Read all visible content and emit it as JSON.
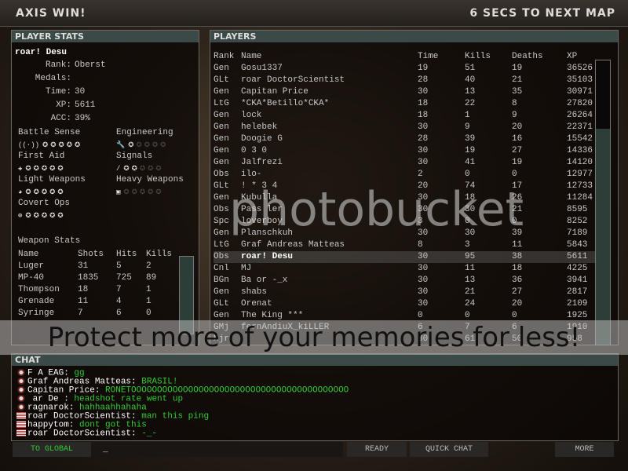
{
  "header": {
    "result": "AXIS WIN!",
    "countdown": "6 SECS TO NEXT MAP"
  },
  "player_stats": {
    "title": "PLAYER STATS",
    "name": "roar! Desu",
    "fields": [
      {
        "label": "Rank:",
        "value": "Oberst"
      },
      {
        "label": "Medals:",
        "value": ""
      },
      {
        "label": "Time:",
        "value": "30"
      },
      {
        "label": "XP:",
        "value": "5611"
      },
      {
        "label": "ACC:",
        "value": "39%"
      }
    ],
    "skills": [
      {
        "name": "Battle Sense",
        "icon": "radio-icon",
        "level": 5
      },
      {
        "name": "Engineering",
        "icon": "wrench-icon",
        "level": 1
      },
      {
        "name": "First Aid",
        "icon": "medic-cross-icon",
        "level": 5
      },
      {
        "name": "Signals",
        "icon": "signals-icon",
        "level": 2
      },
      {
        "name": "Light Weapons",
        "icon": "pistol-icon",
        "level": 5
      },
      {
        "name": "Heavy Weapons",
        "icon": "heavy-weapon-icon",
        "level": 0
      },
      {
        "name": "Covert Ops",
        "icon": "crosshair-icon",
        "level": 5
      }
    ],
    "weapon_stats": {
      "title": "Weapon Stats",
      "columns": [
        "Name",
        "Shots",
        "Hits",
        "Kills"
      ],
      "rows": [
        [
          "Luger",
          "31",
          "5",
          "2"
        ],
        [
          "MP-40",
          "1835",
          "725",
          "89"
        ],
        [
          "Thompson",
          "18",
          "7",
          "1"
        ],
        [
          "Grenade",
          "11",
          "4",
          "1"
        ],
        [
          "Syringe",
          "7",
          "6",
          "0"
        ]
      ]
    }
  },
  "players": {
    "title": "PLAYERS",
    "columns": [
      "Rank",
      "Name",
      "Time",
      "Kills",
      "Deaths",
      "XP"
    ],
    "rows": [
      [
        "Gen",
        "Gosu1337",
        "19",
        "51",
        "19",
        "36526"
      ],
      [
        "GLt",
        "roar DoctorScientist",
        "28",
        "40",
        "21",
        "35103"
      ],
      [
        "Gen",
        "Capitan Price",
        "30",
        "13",
        "35",
        "30971"
      ],
      [
        "LtG",
        "*CKA*Betillo*CKA*",
        "18",
        "22",
        "8",
        "27820"
      ],
      [
        "Gen",
        "lock",
        "18",
        "1",
        "9",
        "26264"
      ],
      [
        "Gen",
        "helebek",
        "30",
        "9",
        "20",
        "22371"
      ],
      [
        "Gen",
        "Doogie G",
        "28",
        "39",
        "16",
        "15542"
      ],
      [
        "Gen",
        " 0 3  0",
        "30",
        "19",
        "27",
        "14336"
      ],
      [
        "Gen",
        "Jalfrezi",
        "30",
        "41",
        "19",
        "14120"
      ],
      [
        "Obs",
        "  ilo-",
        "2",
        "0",
        "0",
        "12977"
      ],
      [
        "GLt",
        "  !  * 3  4",
        "20",
        "74",
        "17",
        "12733"
      ],
      [
        "Gen",
        "Kubulla",
        "30",
        "18",
        "26",
        "11284"
      ],
      [
        "Obs",
        "Pass   ler",
        "30",
        "30",
        "21",
        "8595"
      ],
      [
        "Spc",
        "loverboy",
        "3",
        "0",
        "0",
        "8252"
      ],
      [
        "Gen",
        "Planschkuh",
        "30",
        "30",
        "39",
        "7189"
      ],
      [
        "LtG",
        "Graf Andreas Matteas",
        "8",
        "3",
        "11",
        "5843"
      ],
      [
        "Obs",
        "roar! Desu",
        "30",
        "95",
        "38",
        "5611"
      ],
      [
        "Cnl",
        "MJ",
        "30",
        "11",
        "18",
        "4225"
      ],
      [
        "BGn",
        "Ba   or -_x",
        "30",
        "13",
        "36",
        "3941"
      ],
      [
        "Gen",
        "shabs",
        "30",
        "21",
        "27",
        "2817"
      ],
      [
        "GLt",
        "Orenat",
        "30",
        "24",
        "20",
        "2109"
      ],
      [
        "Gen",
        "The King ***",
        "0",
        "0",
        "0",
        "1925"
      ],
      [
        "GMj",
        "fernAndiuX_kiLLER",
        "6",
        "7",
        "6",
        "1910"
      ],
      [
        "Mjr",
        "",
        "30",
        "61",
        "50",
        "958"
      ]
    ],
    "highlight_index": 16
  },
  "chat": {
    "title": "CHAT",
    "lines": [
      {
        "flag": "axis",
        "name": "F A    EAG",
        "msg": "gg"
      },
      {
        "flag": "axis",
        "name": "Graf Andreas Matteas",
        "msg": "BRASIL!"
      },
      {
        "flag": "axis",
        "name": "Capitan Price",
        "msg": "RONETOOOOOOOOOOOOOOOOOOOOOOOOOOOOOOOOOOOOOOOOOO"
      },
      {
        "flag": "axis",
        "name": " ar  De  ",
        "msg": "headshot rate went up"
      },
      {
        "flag": "axis",
        "name": "ragnarok",
        "msg": "hahhaahhahaha"
      },
      {
        "flag": "us",
        "name": "roar DoctorScientist",
        "msg": "man this ping"
      },
      {
        "flag": "us",
        "name": "happytom",
        "msg": "dont got this"
      },
      {
        "flag": "us",
        "name": "roar DoctorScientist",
        "msg": "-_-"
      }
    ],
    "input_value": "_"
  },
  "buttons": {
    "to_global": "TO GLOBAL",
    "ready": "READY",
    "quick_chat": "QUICK CHAT",
    "more": "MORE"
  },
  "watermark": {
    "logo": "photobucket",
    "tagline": "Protect more of your memories for less!"
  },
  "colors": {
    "header_bg": "#3b4a46",
    "chat_text": "#33cc33",
    "scroll_thumb": "#2d3d38"
  }
}
